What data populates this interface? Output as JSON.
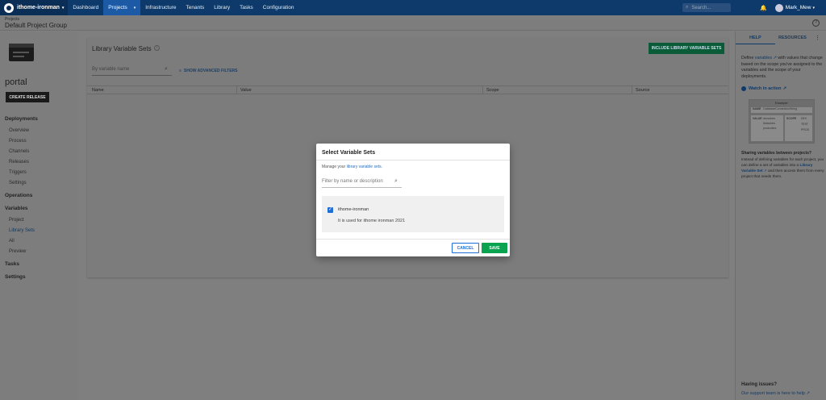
{
  "navbar": {
    "space_name": "ithome-ironman",
    "items": [
      "Dashboard",
      "Projects",
      "Infrastructure",
      "Tenants",
      "Library",
      "Tasks",
      "Configuration"
    ],
    "search_placeholder": "Search...",
    "user_name": "Mark_Mew"
  },
  "header": {
    "breadcrumb": "Projects",
    "project_group": "Default Project Group"
  },
  "sidebar": {
    "project_name": "portal",
    "create_release": "CREATE RELEASE",
    "deployments": "Deployments",
    "deploy_items": [
      "Overview",
      "Process",
      "Channels",
      "Releases",
      "Triggers",
      "Settings"
    ],
    "operations": "Operations",
    "variables": "Variables",
    "variable_items": [
      "Project",
      "Library Sets",
      "All",
      "Preview"
    ],
    "tasks": "Tasks",
    "settings": "Settings"
  },
  "main": {
    "title": "Library Variable Sets",
    "include_button": "INCLUDE LIBRARY VARIABLE SETS",
    "filter_placeholder": "By variable name",
    "advanced_filters": "SHOW ADVANCED FILTERS",
    "columns": [
      "Name",
      "Value",
      "Scope",
      "Source"
    ]
  },
  "right_panel": {
    "tab_help": "HELP",
    "tab_resources": "RESOURCES",
    "intro_1": "Define",
    "intro_link": "variables",
    "intro_2": "with values that change based on the scope you've assigned to the variables and the scope of your deployments.",
    "watch": "Watch in action",
    "example_label": "Example",
    "ex_name_key": "NAME",
    "ex_name_val": "DatabaseConnectionString",
    "ex_value_key": "VALUE",
    "ex_values": [
      "devcubes",
      "testcubes",
      "prodcubes"
    ],
    "ex_scope_key": "SCOPE",
    "ex_scopes": [
      "DEV",
      "TEST",
      "PROD"
    ],
    "sharing_title": "Sharing variables between projects?",
    "sharing_text_1": "Instead of defining variables for each project, you can define a set of variables into a",
    "sharing_link": "Library Variable Set",
    "sharing_text_2": "and then access them from every project that needs them.",
    "issues_title": "Having issues?",
    "support_link": "Our support team is here to help"
  },
  "modal": {
    "title": "Select Variable Sets",
    "desc_prefix": "Manage your",
    "desc_link": "library variable sets.",
    "filter_placeholder": "Filter by name or description",
    "set_name": "ithome-ironman",
    "set_description": "It is used for ithome ironman 2021",
    "cancel": "CANCEL",
    "save": "SAVE"
  }
}
